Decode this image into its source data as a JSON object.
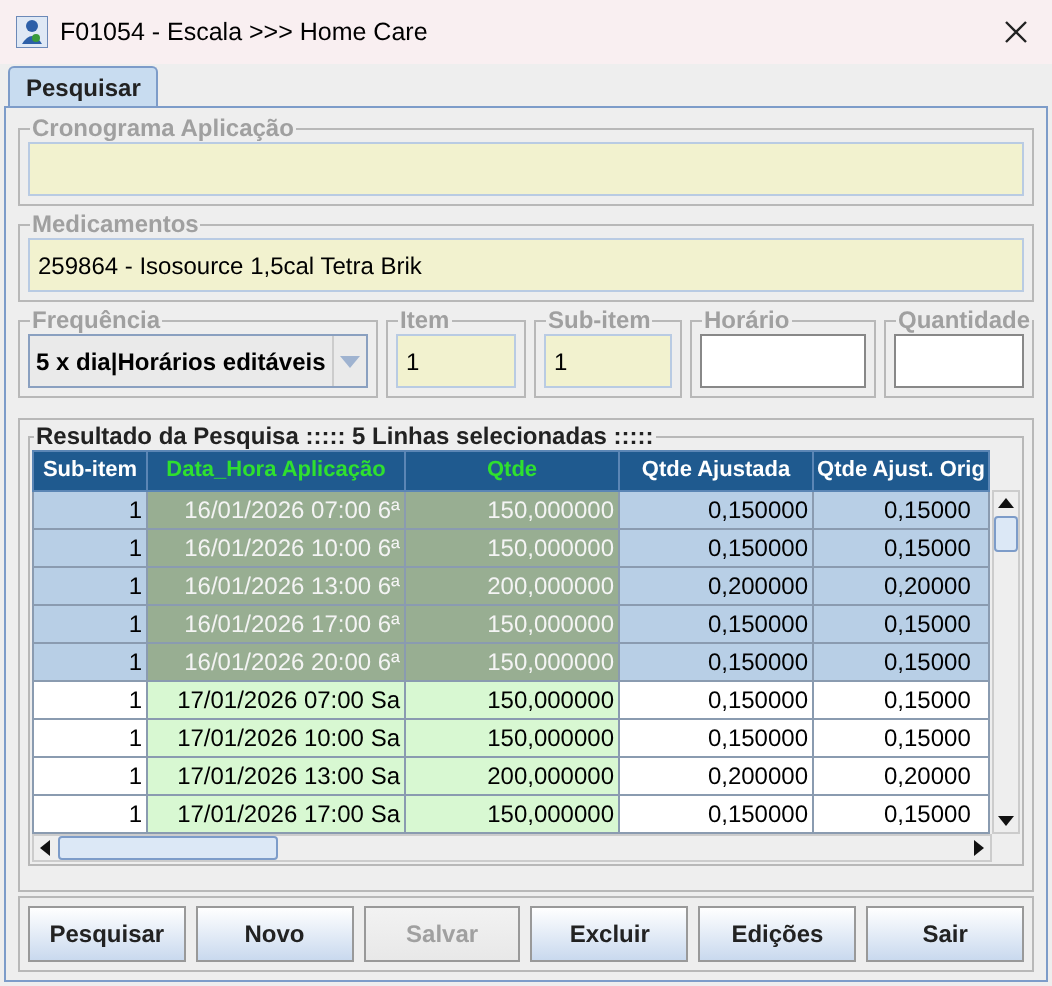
{
  "window": {
    "title": "F01054 - Escala >>> Home Care"
  },
  "tabs": [
    {
      "label": "Pesquisar",
      "selected": true
    }
  ],
  "cronograma": {
    "label": "Cronograma Aplicação"
  },
  "medicamentos": {
    "label": "Medicamentos",
    "value": "259864 - Isosource 1,5cal Tetra Brik"
  },
  "frequencia": {
    "label": "Frequência",
    "value": "5 x dia|Horários editáveis"
  },
  "item": {
    "label": "Item",
    "value": "1"
  },
  "sub_item": {
    "label": "Sub-item",
    "value": "1"
  },
  "horario": {
    "label": "Horário"
  },
  "quantidade": {
    "label": "Quantidade"
  },
  "result": {
    "title": "Resultado da Pesquisa ::::: 5 Linhas selecionadas :::::"
  },
  "table": {
    "columns": [
      {
        "label": "Sub-item",
        "highlighted": false
      },
      {
        "label": "Data_Hora Aplicação",
        "highlighted": true
      },
      {
        "label": "Qtde",
        "highlighted": true
      },
      {
        "label": "Qtde Ajustada",
        "highlighted": false
      },
      {
        "label": "Qtde Ajust. Orig",
        "highlighted": false
      }
    ],
    "rows": [
      {
        "selected": true,
        "cells": [
          "1",
          "16/01/2026 07:00 6ª",
          "150,000000",
          "0,150000",
          "0,15000"
        ]
      },
      {
        "selected": true,
        "cells": [
          "1",
          "16/01/2026 10:00 6ª",
          "150,000000",
          "0,150000",
          "0,15000"
        ]
      },
      {
        "selected": true,
        "cells": [
          "1",
          "16/01/2026 13:00 6ª",
          "200,000000",
          "0,200000",
          "0,20000"
        ]
      },
      {
        "selected": true,
        "cells": [
          "1",
          "16/01/2026 17:00 6ª",
          "150,000000",
          "0,150000",
          "0,15000"
        ]
      },
      {
        "selected": true,
        "cells": [
          "1",
          "16/01/2026 20:00 6ª",
          "150,000000",
          "0,150000",
          "0,15000"
        ]
      },
      {
        "selected": false,
        "cells": [
          "1",
          "17/01/2026 07:00 Sa",
          "150,000000",
          "0,150000",
          "0,15000"
        ]
      },
      {
        "selected": false,
        "cells": [
          "1",
          "17/01/2026 10:00 Sa",
          "150,000000",
          "0,150000",
          "0,15000"
        ]
      },
      {
        "selected": false,
        "cells": [
          "1",
          "17/01/2026 13:00 Sa",
          "200,000000",
          "0,200000",
          "0,20000"
        ]
      },
      {
        "selected": false,
        "cells": [
          "1",
          "17/01/2026 17:00 Sa",
          "150,000000",
          "0,150000",
          "0,15000"
        ]
      }
    ]
  },
  "buttons": [
    {
      "label": "Pesquisar",
      "disabled": false
    },
    {
      "label": "Novo",
      "disabled": false
    },
    {
      "label": "Salvar",
      "disabled": true
    },
    {
      "label": "Excluir",
      "disabled": false
    },
    {
      "label": "Edições",
      "disabled": false
    },
    {
      "label": "Sair",
      "disabled": false
    }
  ]
}
